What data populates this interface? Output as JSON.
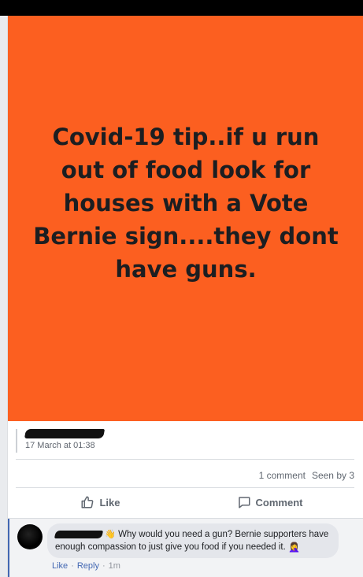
{
  "post": {
    "image_text": "Covid-19 tip..if u run out of food look for houses with a Vote Bernie sign....they dont have guns.",
    "image_bg": "#fc5f20",
    "timestamp": "17 March at 01:38",
    "comment_count": "1 comment",
    "seen_by": "Seen by 3"
  },
  "actions": {
    "like_label": "Like",
    "comment_label": "Comment",
    "like_icon": "thumbs-up-icon",
    "comment_icon": "speech-bubble-icon"
  },
  "comment": {
    "text": "Why would you need a gun? Bernie supporters have enough compassion to just give you food if you needed it.",
    "hand_emoji": "👋",
    "end_emoji": "🤦‍♀️",
    "like": "Like",
    "dot1": "·",
    "reply": "Reply",
    "dot2": "·",
    "time": "1m"
  },
  "colors": {
    "facebook_blue": "#4267b2",
    "meta_gray": "#606770"
  }
}
